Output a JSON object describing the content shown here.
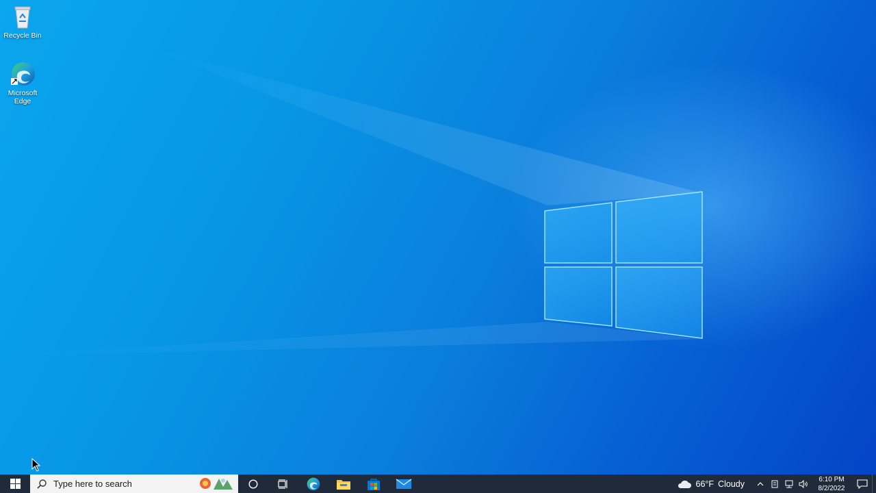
{
  "desktop": {
    "icons": [
      {
        "label": "Recycle Bin",
        "icon": "recycle-bin-icon"
      },
      {
        "label": "Microsoft Edge",
        "icon": "edge-icon"
      }
    ]
  },
  "taskbar": {
    "start_icon": "windows-logo-icon",
    "search": {
      "placeholder": "Type here to search"
    },
    "apps": [
      {
        "name": "cortana",
        "icon": "circle-icon"
      },
      {
        "name": "task-view",
        "icon": "task-view-icon"
      },
      {
        "name": "edge",
        "icon": "edge-icon"
      },
      {
        "name": "file-explorer",
        "icon": "folder-icon"
      },
      {
        "name": "microsoft-store",
        "icon": "store-icon"
      },
      {
        "name": "mail",
        "icon": "mail-icon"
      }
    ],
    "weather": {
      "temp": "66°F",
      "condition": "Cloudy"
    },
    "clock": {
      "time": "6:10 PM",
      "date": "8/2/2022"
    }
  },
  "colors": {
    "taskbar": "#1f2a3a",
    "desktop_accent": "#0a7fdc",
    "store_blue": "#0078d4"
  }
}
